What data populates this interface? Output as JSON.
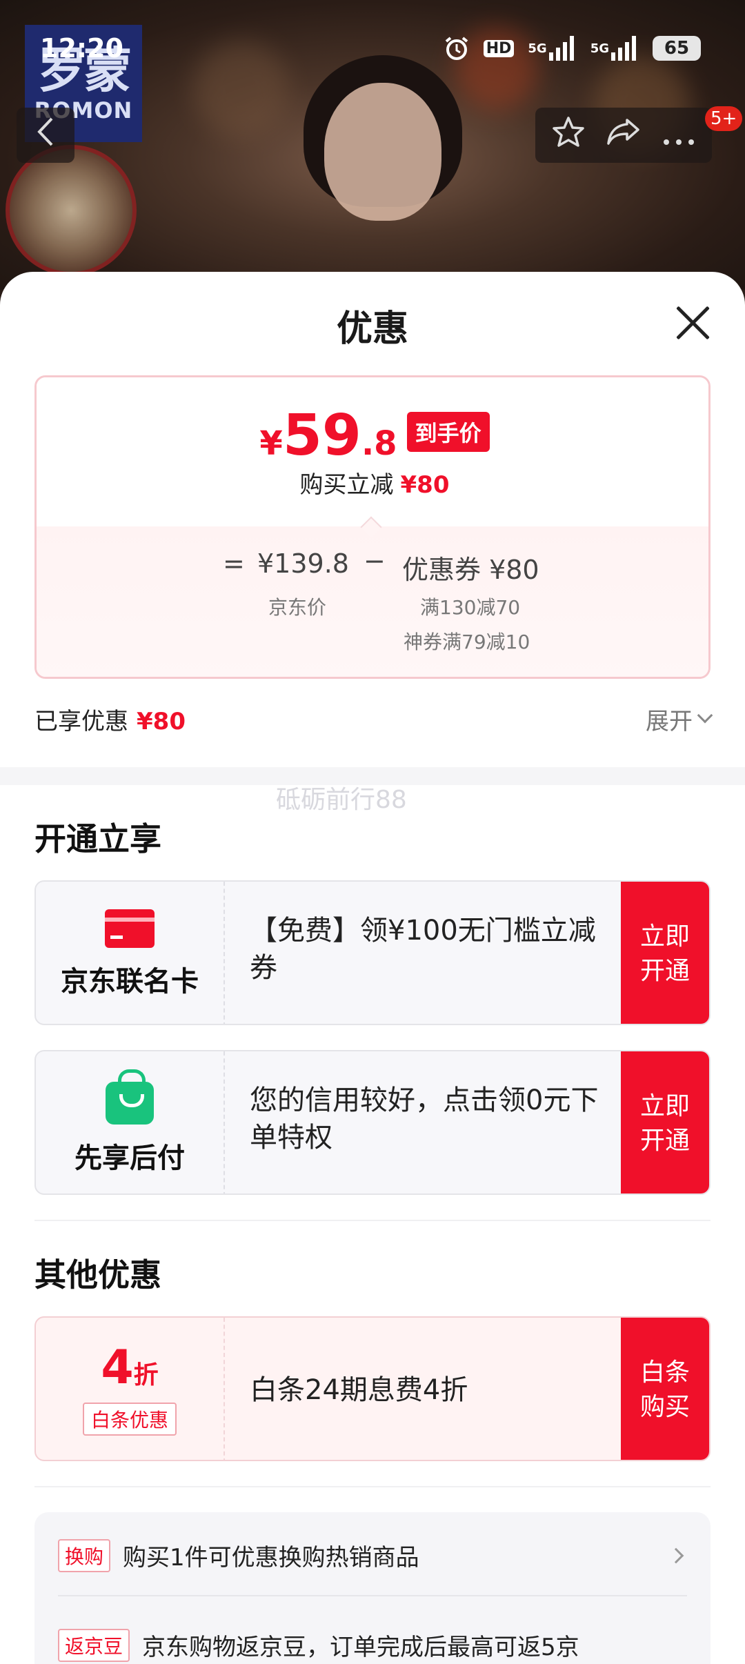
{
  "status_bar": {
    "time": "12:20",
    "hd": "HD",
    "net1": "5G",
    "net2": "5G",
    "battery": "65"
  },
  "brand": {
    "cn": "罗蒙",
    "en": "ROMON"
  },
  "nav": {
    "more_badge": "5+"
  },
  "sheet": {
    "title": "优惠",
    "final_price": {
      "yen": "¥",
      "integer": "59",
      "decimal": ".8",
      "tag": "到手价"
    },
    "instant_reduce": {
      "label": "购买立减",
      "amount": "¥80"
    },
    "calc": {
      "eq": "=",
      "jd_price": "¥139.8",
      "jd_price_label": "京东价",
      "minus": "−",
      "coupon": "优惠券 ¥80",
      "coupon_line1": "满130减70",
      "coupon_line2": "神券满79减10"
    },
    "enjoyed": {
      "label": "已享优惠",
      "amount": "¥80"
    },
    "expand_label": "展开",
    "watermark": "砥砺前行88"
  },
  "open_section": {
    "title": "开通立享",
    "offers": [
      {
        "name": "京东联名卡",
        "desc": "【免费】领¥100无门槛立减券",
        "cta": "立即开通",
        "icon": "card-icon"
      },
      {
        "name": "先享后付",
        "desc": "您的信用较好，点击领0元下单特权",
        "cta": "立即开通",
        "icon": "shopping-bag-icon"
      }
    ]
  },
  "other_section": {
    "title": "其他优惠",
    "baitiao": {
      "num": "4",
      "unit": "折",
      "tag": "白条优惠",
      "desc": "白条24期息费4折",
      "cta": "白条购买"
    }
  },
  "extras": [
    {
      "tag": "换购",
      "text": "购买1件可优惠换购热销商品"
    },
    {
      "tag": "返京豆",
      "text": "京东购物返京豆，订单完成后最高可返5京"
    }
  ],
  "colors": {
    "accent": "#f0102a",
    "green": "#19c37d"
  }
}
